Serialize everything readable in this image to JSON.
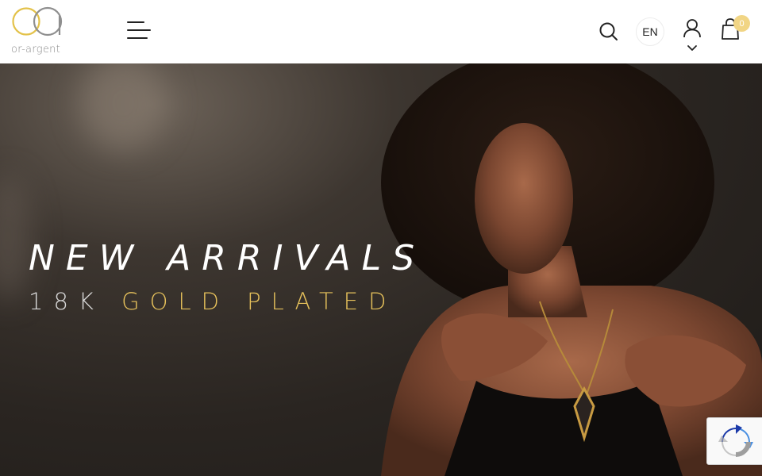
{
  "header": {
    "logo_text": "or-argent",
    "language": "EN",
    "cart_count": "0"
  },
  "hero": {
    "title": "NEW ARRIVALS",
    "subtitle_part1": "18K",
    "subtitle_part2": "GOLD PLATED"
  },
  "colors": {
    "accent_gold": "#e6c15b",
    "logo_gold": "#e3c24a",
    "cart_badge": "#f1d585"
  }
}
